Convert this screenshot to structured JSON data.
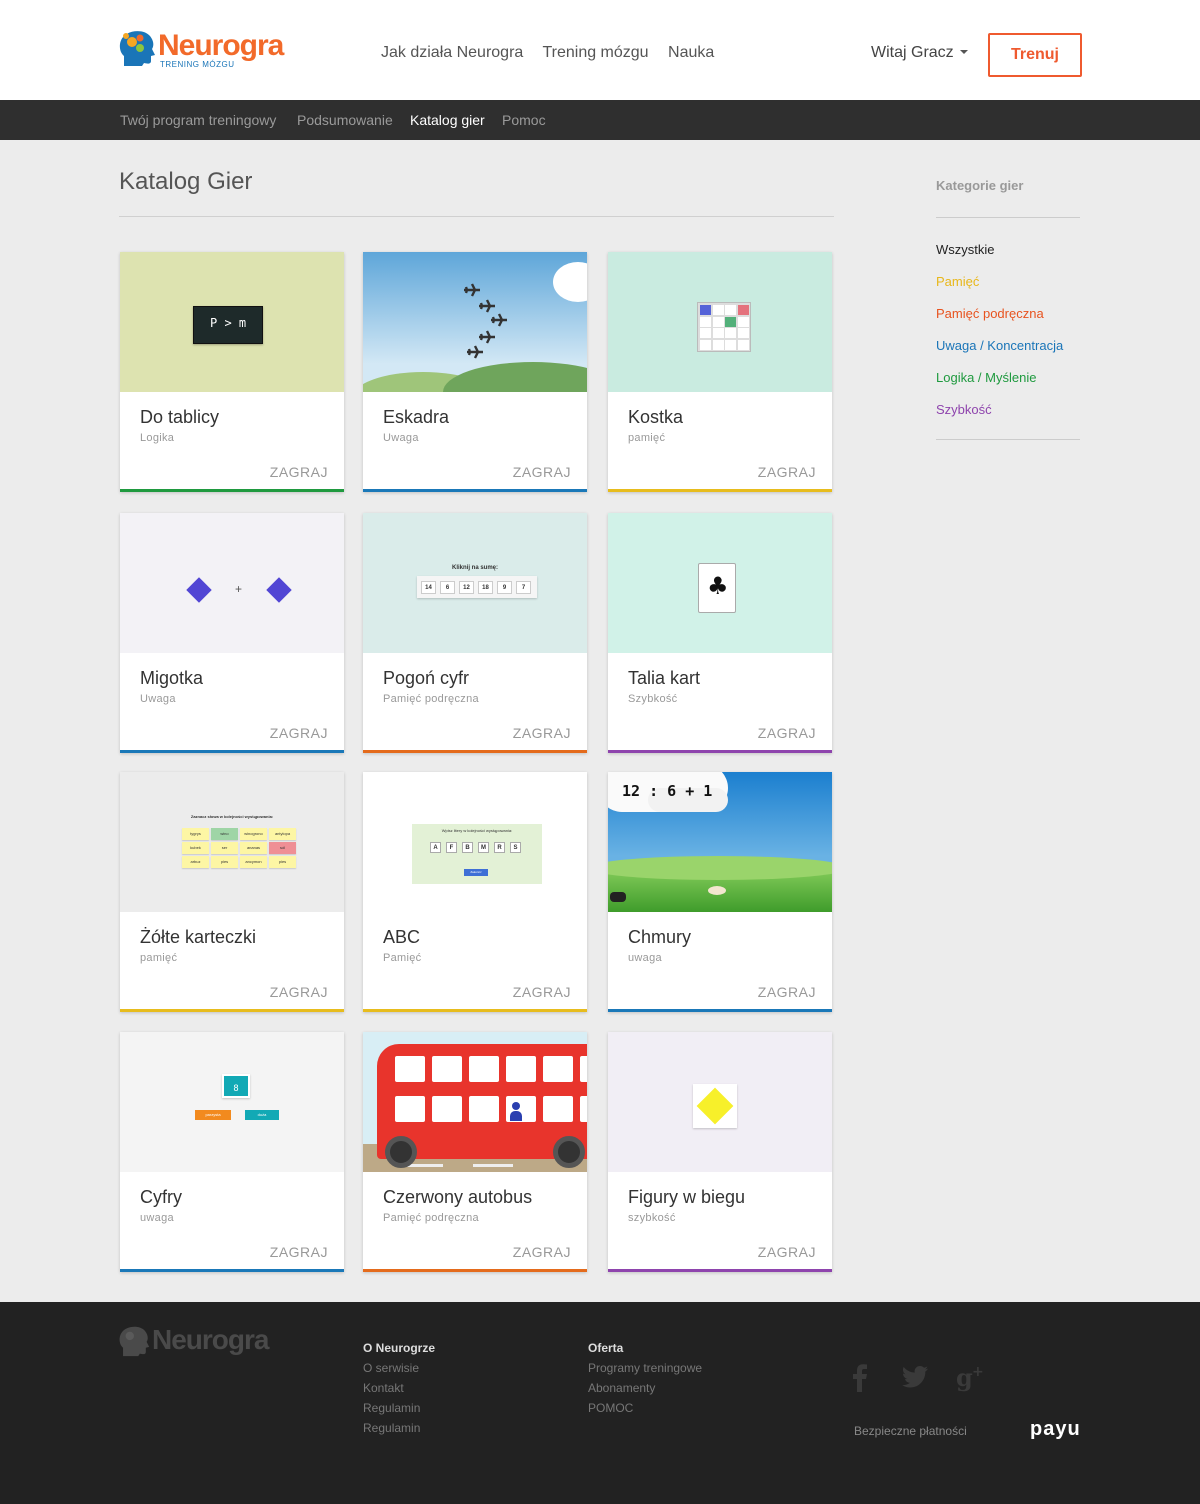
{
  "brand": {
    "name": "Neurogra",
    "tagline": "TRENING MÓZGU"
  },
  "topnav": [
    "Jak działa Neurogra",
    "Trening mózgu",
    "Nauka"
  ],
  "user": {
    "greeting": "Witaj Gracz"
  },
  "train_button": "Trenuj",
  "subnav": [
    {
      "label": "Twój program treningowy",
      "active": false
    },
    {
      "label": "Podsumowanie",
      "active": false
    },
    {
      "label": "Katalog gier",
      "active": true
    },
    {
      "label": "Pomoc",
      "active": false
    }
  ],
  "page_title": "Katalog Gier",
  "play_label": "ZAGRAJ",
  "games": [
    {
      "name": "Do tablicy",
      "category": "Logika",
      "color": "#1f9a3f",
      "thumb": "blackboard"
    },
    {
      "name": "Eskadra",
      "category": "Uwaga",
      "color": "#1a78b8",
      "thumb": "planes"
    },
    {
      "name": "Kostka",
      "category": "pamięć",
      "color": "#e7bc1d",
      "thumb": "grid"
    },
    {
      "name": "Migotka",
      "category": "Uwaga",
      "color": "#1a78b8",
      "thumb": "diamonds"
    },
    {
      "name": "Pogoń cyfr",
      "category": "Pamięć podręczna",
      "color": "#e46b1c",
      "thumb": "numbers"
    },
    {
      "name": "Talia kart",
      "category": "Szybkość",
      "color": "#8e44ad",
      "thumb": "card"
    },
    {
      "name": "Żółte karteczki",
      "category": "pamięć",
      "color": "#e7bc1d",
      "thumb": "notes"
    },
    {
      "name": "ABC",
      "category": "Pamięć",
      "color": "#e7bc1d",
      "thumb": "abc"
    },
    {
      "name": "Chmury",
      "category": "uwaga",
      "color": "#1a78b8",
      "thumb": "clouds"
    },
    {
      "name": "Cyfry",
      "category": "uwaga",
      "color": "#1a78b8",
      "thumb": "digits"
    },
    {
      "name": "Czerwony autobus",
      "category": "Pamięć podręczna",
      "color": "#e46b1c",
      "thumb": "bus"
    },
    {
      "name": "Figury w biegu",
      "category": "szybkość",
      "color": "#8e44ad",
      "thumb": "figure"
    }
  ],
  "thumb_text": {
    "blackboard": "P > m",
    "numbers_prompt": "Kliknij na sumę:",
    "numbers": [
      "14",
      "6",
      "12",
      "18",
      "9",
      "7"
    ],
    "notes_prompt": "Zaznacz słowa w kolejności wystąpowania:",
    "notes": [
      "tygrys",
      "wino",
      "winogrono",
      "antylopa",
      "kubek",
      "ser",
      "ananas",
      "sól",
      "arbuz",
      "pies",
      "ancymon",
      "pies"
    ],
    "abc_prompt": "Wpisz litery w kolejności wystąpowania:",
    "abc_letters": [
      "A",
      "F",
      "B",
      "M",
      "R",
      "S"
    ],
    "abc_button": "Zakończ",
    "clouds_equation": "12 : 6 + 1",
    "digits_value": "8",
    "digits_left": "parzysta",
    "digits_right": "duża"
  },
  "sidebar": {
    "title": "Kategorie gier",
    "items": [
      {
        "label": "Wszystkie",
        "color": "#222222"
      },
      {
        "label": "Pamięć",
        "color": "#e8b71a"
      },
      {
        "label": "Pamięć podręczna",
        "color": "#e8531f"
      },
      {
        "label": "Uwaga / Koncentracja",
        "color": "#1a75b8"
      },
      {
        "label": "Logika / Myślenie",
        "color": "#1f9a3f"
      },
      {
        "label": "Szybkość",
        "color": "#8e44ad"
      }
    ]
  },
  "footer": {
    "brand": "Neurogra",
    "col1": {
      "title": "O Neurogrze",
      "links": [
        "O serwisie",
        "Kontakt",
        "Regulamin",
        "Regulamin"
      ]
    },
    "col2": {
      "title": "Oferta",
      "links": [
        "Programy treningowe",
        "Abonamenty",
        "POMOC"
      ]
    },
    "secure_payments": "Bezpieczne płatności",
    "payment_brand": "payu",
    "social": [
      "facebook-icon",
      "twitter-icon",
      "google-plus-icon"
    ]
  }
}
